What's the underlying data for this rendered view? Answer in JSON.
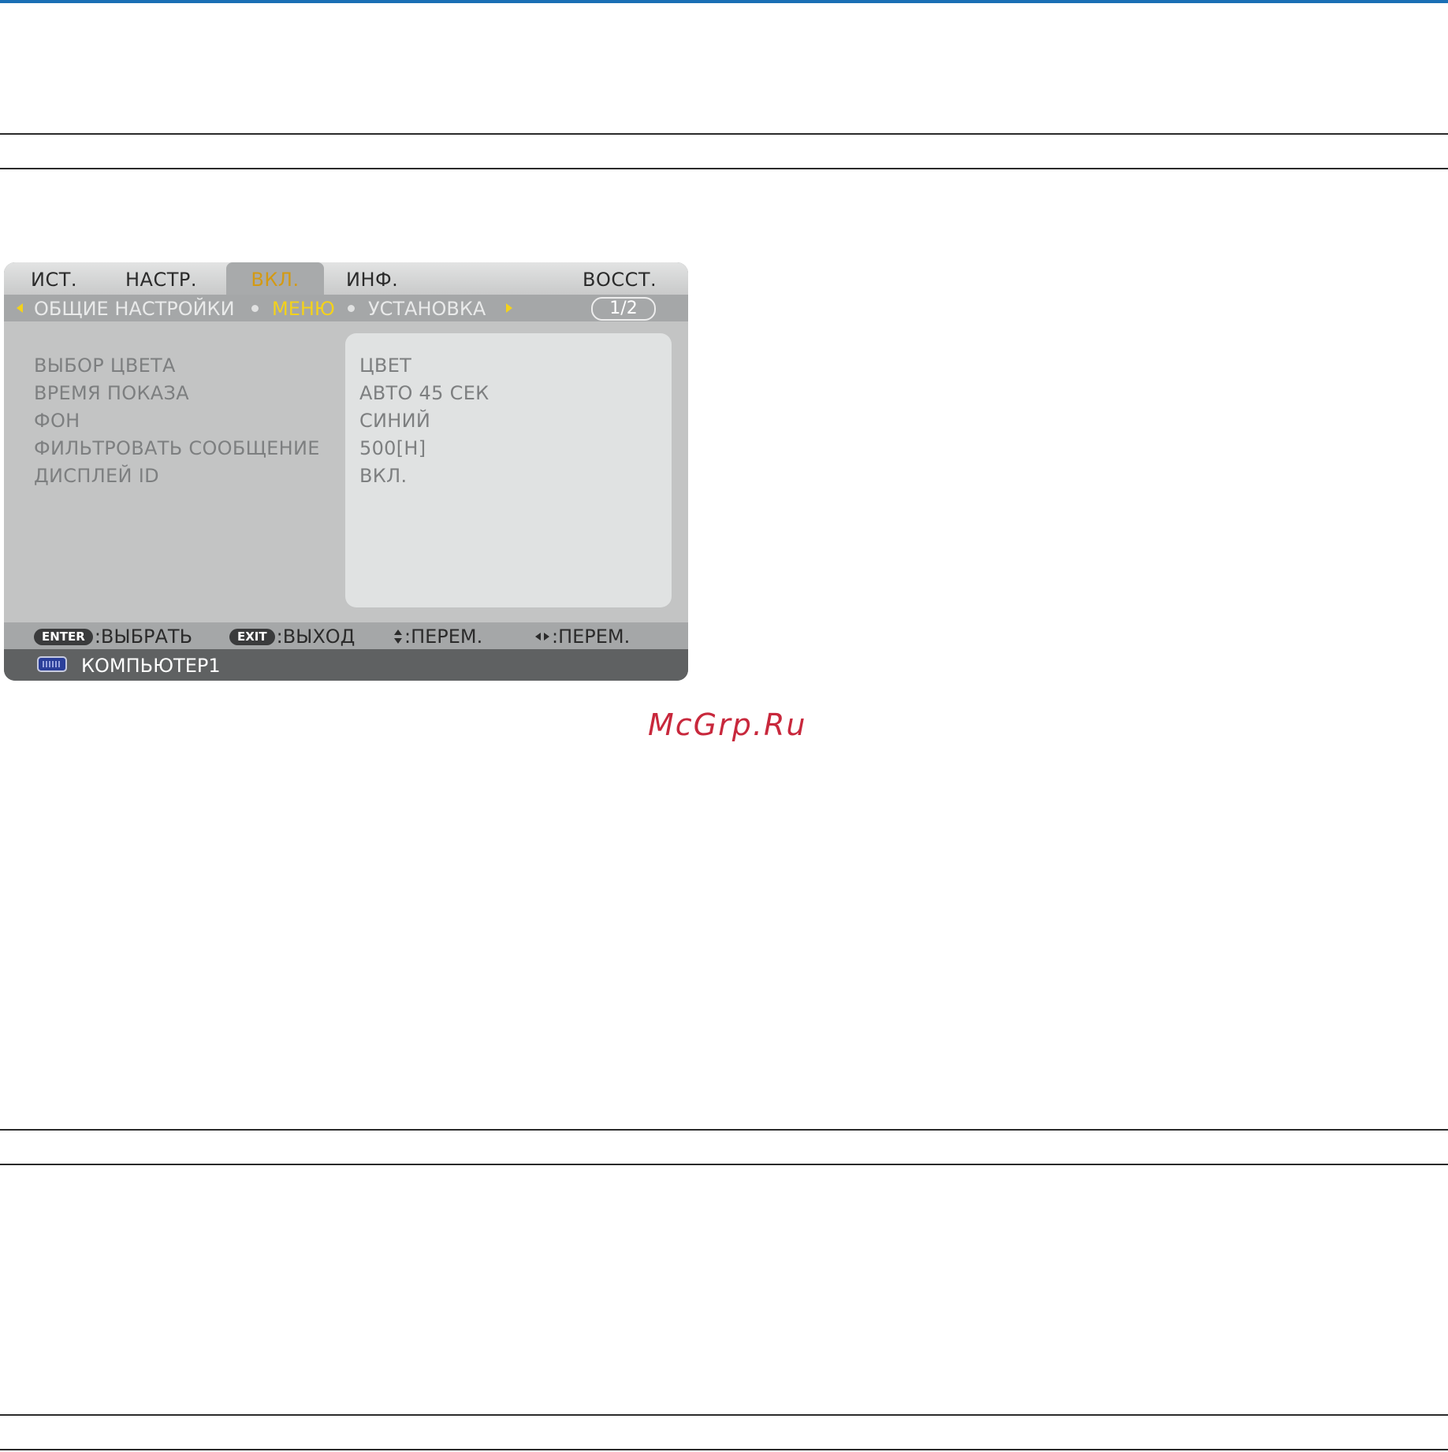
{
  "menu": {
    "tabs": [
      {
        "label": "ИСТ.",
        "active": false
      },
      {
        "label": "НАСТР.",
        "active": false
      },
      {
        "label": "ВКЛ.",
        "active": true
      },
      {
        "label": "ИНФ.",
        "active": false
      },
      {
        "label": "ВОССТ.",
        "active": false
      }
    ],
    "subtabs": [
      {
        "label": "ОБЩИЕ НАСТРОЙКИ",
        "active": false
      },
      {
        "label": "МЕНЮ",
        "active": true
      },
      {
        "label": "УСТАНОВКА",
        "active": false
      }
    ],
    "page_indicator": "1/2",
    "rows": [
      {
        "label": "ВЫБОР ЦВЕТА",
        "value": "ЦВЕТ"
      },
      {
        "label": "ВРЕМЯ ПОКАЗА",
        "value": "АВТО 45 СЕК"
      },
      {
        "label": "ФОН",
        "value": "СИНИЙ"
      },
      {
        "label": "ФИЛЬТРОВАТЬ СООБЩЕНИЕ",
        "value": "500[H]"
      },
      {
        "label": "ДИСПЛЕЙ ID",
        "value": "ВКЛ."
      }
    ],
    "help": {
      "enter_key": "ENTER",
      "enter_text": ":ВЫБРАТЬ",
      "exit_key": "EXIT",
      "exit_text": ":ВЫХОД",
      "updown_text": ":ПЕРЕМ.",
      "leftright_text": ":ПЕРЕМ."
    },
    "source": {
      "icon": "computer-monitor-icon",
      "label": "КОМПЬЮТЕР1"
    }
  },
  "watermark": "McGrp.Ru",
  "colors": {
    "accent_line": "#1a6fb5",
    "active_tab_text": "#d49a12",
    "active_subtab_text": "#f4d21a",
    "watermark": "#c8283c"
  }
}
